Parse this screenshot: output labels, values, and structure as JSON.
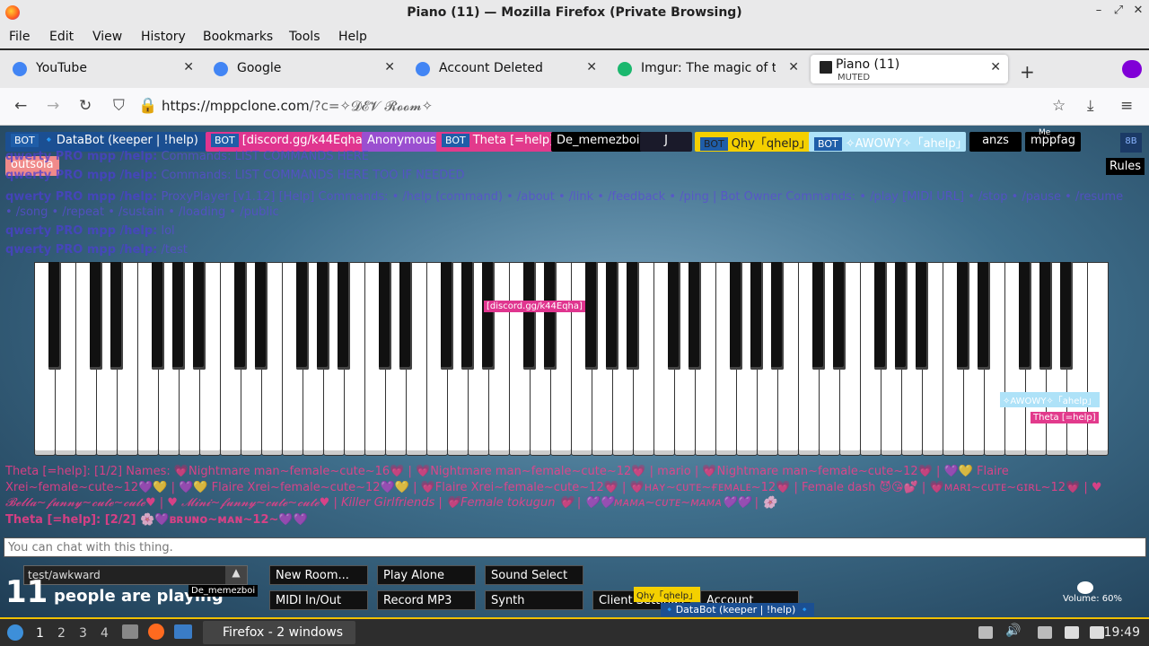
{
  "window": {
    "title": "Piano (11) — Mozilla Firefox (Private Browsing)"
  },
  "menu": [
    "File",
    "Edit",
    "View",
    "History",
    "Bookmarks",
    "Tools",
    "Help"
  ],
  "tabs": [
    {
      "label": "YouTube",
      "sub": ""
    },
    {
      "label": "Google",
      "sub": ""
    },
    {
      "label": "Account Deleted",
      "sub": ""
    },
    {
      "label": "Imgur: The magic of the",
      "sub": ""
    },
    {
      "label": "Piano (11)",
      "sub": "MUTED"
    }
  ],
  "url": {
    "host": "https://mppclone.com",
    "rest": "/?c=✧𝓓𝓔𝓥 𝓡𝓸𝓸𝓶✧"
  },
  "users": [
    {
      "bot": "BOT",
      "name": "🔹DataBot (keeper | !help) 🔹",
      "color": "#1b4f92"
    },
    {
      "bot": "BOT",
      "name": "[discord.gg/k44Eqha]",
      "color": "#e0358f"
    },
    {
      "bot": "",
      "name": "Anonymous",
      "color": "#9a4fd0"
    },
    {
      "bot": "BOT",
      "name": "Theta [=help]",
      "color": "#e23a8c"
    },
    {
      "bot": "",
      "name": "De_memezboi",
      "color": "#000000"
    },
    {
      "bot": "",
      "name": "J",
      "color": "#1a1a2a"
    },
    {
      "bot": "BOT",
      "name": "Qhy「qhelp」",
      "color": "#f4d000"
    },
    {
      "bot": "BOT",
      "name": "✧AWOWY✧「ahelp」",
      "color": "#aee2f8"
    },
    {
      "bot": "",
      "name": "anzs",
      "color": "#000000"
    },
    {
      "bot": "",
      "name": "mppfag",
      "color": "#000000"
    },
    {
      "bot": "",
      "name": "outsola",
      "color": "#f08a8a"
    }
  ],
  "me_label": "Me",
  "badge": "8B",
  "rules": "Rules",
  "chat": [
    {
      "user": "qwerty PRO mpp /help:",
      "text": "Commands: LIST COMMANDS HERE"
    },
    {
      "user": "qwerty PRO mpp /help:",
      "text": "Commands: LIST COMMANDS HERE TOO IF NEEDED"
    },
    {
      "user": "qwerty PRO mpp /help:",
      "text": "ProxyPlayer [v1.12] [Help] Commands: • /help (command) • /about • /link • /feedback • /ping | Bot Owner Commands: • /play [MIDI URL] • /stop • /pause • /resume"
    },
    {
      "user": "",
      "text": "• /song • /repeat • /sustain • /loading • /public"
    },
    {
      "user": "qwerty PRO mpp /help:",
      "text": "lol"
    },
    {
      "user": "qwerty PRO mpp /help:",
      "text": "/test"
    }
  ],
  "chat_bottom": [
    "Theta [=help]: [1/2] Names: 💗Nightmare man~female~cute~16💗 | 💗Nightmare man~female~cute~12💗 | mario | 💗Nightmare man~female~cute~12💗 | 💜💛 Flaire",
    "Xrei~female~cute~12💜💛 | 💜💛 Flaire Xrei~female~cute~12💜💛 | 💗Flaire Xrei~female~cute~12💗 | 💗ʜᴀʏ~ᴄᴜᴛᴇ~ғᴇᴍᴀʟᴇ~12💗 | Female dash 😈😘💕 | 💗ᴍᴀʀɪ~ᴄᴜᴛᴇ~ɢɪʀʟ~12💗 | ♥",
    "𝓑𝓮𝓵𝓵𝓪~𝓯𝓾𝓷𝓷𝔂~𝓬𝓾𝓽𝓮~𝓬𝓾𝓽𝓮♥ | ♥ 𝓜𝓲𝓷𝓲~𝓯𝓾𝓷𝓷𝔂~𝓬𝓾𝓽𝓮~𝓬𝓾𝓽𝓮♥ | Killer Girlfriends | 💗Female tokugun 💗 | 💜💜ᴍᴀᴍᴀ~ᴄᴜᴛᴇ~ᴍᴀᴍᴀ💜💜 | 🌸",
    "Theta [=help]: [2/2] 🌸💜ʙʀᴜɴᴏ~ᴍᴀɴ~12~💜💜"
  ],
  "chat_placeholder": "You can chat with this thing.",
  "cursors": [
    {
      "name": "[discord.gg/k44Eqha]",
      "color": "#e0358f"
    },
    {
      "name": "✧AWOWY✧「ahelp」",
      "color": "#aee2f8"
    },
    {
      "name": "Theta [=help]",
      "color": "#e23a8c"
    },
    {
      "name": "De_memezboi",
      "color": "#000000"
    },
    {
      "name": "Qhy「qhelp」",
      "color": "#f4d000"
    },
    {
      "name": "🔹DataBot (keeper | !help) 🔹",
      "color": "#1b4f92"
    }
  ],
  "room": {
    "name": "test/awkward",
    "count": "11",
    "count_label": "people are playing"
  },
  "controls": {
    "new_room": "New Room...",
    "play_alone": "Play Alone",
    "sound_select": "Sound Select",
    "midi": "MIDI In/Out",
    "record": "Record MP3",
    "synth": "Synth",
    "client_settings": "Client Settings",
    "account": "Account",
    "volume": "Volume: 60%"
  },
  "taskbar": {
    "workspaces": [
      "1",
      "2",
      "3",
      "4"
    ],
    "task": "Firefox - 2 windows",
    "clock": "19:49"
  }
}
